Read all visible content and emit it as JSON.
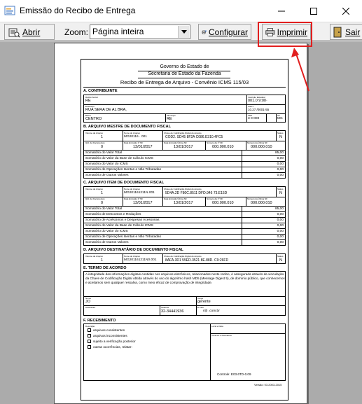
{
  "window": {
    "title": "Emissão do Recibo de Entrega",
    "controls": {
      "minimize": "minimize",
      "maximize": "maximize",
      "close": "close"
    }
  },
  "toolbar": {
    "open_label": "Abrir",
    "zoom_label": "Zoom:",
    "zoom_value": "Página inteira",
    "config_label": "Configurar",
    "print_label": "Imprimir",
    "exit_label": "Sair",
    "highlight_color": "#e11f1f"
  },
  "document": {
    "header": {
      "line1": "Governo do Estado de",
      "line2": "Secretaria de Estado da Fazenda",
      "line3": "Recibo de Entrega de Arquivo - Convênio ICMS 115/03"
    },
    "section_a": {
      "title": "A. CONTRIBUINTE",
      "razao_label": "Razão Social",
      "razao_value": "RE",
      "ie_label": "Inscrição Estadual",
      "ie_value": "001.0 9:00·",
      "endereco_label": "Endereço",
      "endereco_value": "RUA SERA DE AL BRA,",
      "cnpj_label": "CNPJ",
      "cnpj_value": "10.27 /0001-55",
      "bairro_label": "Bairro",
      "bairro_value": "CENTRO",
      "municipio_label": "Município",
      "municipio_value": "RE",
      "cep_label": "CEP",
      "cep_value": "3 0-000",
      "uf_label": "UF",
      "uf_value": "MG"
    },
    "section_b": {
      "title": "B. ARQUIVO MESTRE DE DOCUMENTO FISCAL",
      "volumes_label": "Volume da Arquivo",
      "volumes_value": "1",
      "nome_label": "Nome do Arquivo",
      "nome_value": "MG20116 · 001",
      "chave_label": "Chave de Codificação Digital do Arquivo",
      "chave_value": "COD2. SD45 8F2A C086.E310.4FC5",
      "status_label": "Status",
      "status_value": "N",
      "qtd_label": "Qtd. de Documentos",
      "qtd_value": "0",
      "data_ini_label": "Data Emissão 1º NF",
      "data_ini_value": "13/01/2017",
      "data_fim_label": "Data Emissão Última NF",
      "data_fim_value": "13/01/2017",
      "num_ini_label": "Número da 1º NF",
      "num_ini_value": "000.000.010",
      "num_fim_label": "Número da Última NF",
      "num_fim_value": "000.000.010",
      "rows": [
        {
          "label": "Somatório do Valor Total",
          "value": "85,00"
        },
        {
          "label": "Somatório do Valor da Base de Cálculo ICMS",
          "value": "0,00"
        },
        {
          "label": "Somatório do Valor do ICMS",
          "value": "0,00"
        },
        {
          "label": "Somatório de Operações Isentas e Não Tributadas",
          "value": "0,00"
        },
        {
          "label": "Somatório de Outros Valores",
          "value": "0,00"
        }
      ]
    },
    "section_c": {
      "title": "C. ARQUIVO ITEM DE DOCUMENTO FISCAL",
      "volumes_value": "1",
      "nome_value": "MG201161211N.001",
      "chave_value": "5D4A.2D F80C.8511 DFD.946 73.E15D",
      "status_value": "N",
      "qtd_value": "0",
      "data_ini_value": "13/01/2017",
      "data_fim_value": "13/01/2017",
      "num_ini_value": "000.000.010",
      "num_fim_value": "000.000.010",
      "rows": [
        {
          "label": "Somatório do Valor Total",
          "value": "85,00"
        },
        {
          "label": "Somatório de Descontos e Reduções",
          "value": "0,00"
        },
        {
          "label": "Somatório de Acréscimos e Despesas Acessórias",
          "value": "0,00"
        },
        {
          "label": "Somatório do Valor da Base de Cálculo ICMS",
          "value": "0,00"
        },
        {
          "label": "Somatório do Valor do ICMS",
          "value": "0,00"
        },
        {
          "label": "Somatório de Operações Isentas e Não Tributadas",
          "value": "0,00"
        },
        {
          "label": "Somatório de Outros Valores",
          "value": "0,00"
        }
      ]
    },
    "section_d": {
      "title": "D. ARQUIVO DESTINATÁRIO DE DOCUMENTO FISCAL",
      "volumes_value": "1",
      "nome_value": "MG201161211N0.001",
      "chave_value": "8AFA.3D1 55ED.3521 8E.88D. C9:26FD",
      "status_value": "N"
    },
    "section_e": {
      "title": "E. TERMO DE ACORDO",
      "text": "A integridade das informações digitais contidas nos arquivos eletrônicos, relacionados neste recibo, é assegurada através da vinculação da Chave de Codificação Digital obtida através do uso do algoritmo hash MD5 (Message Digest 5), de domínio público, que conhecemos e aceitamos sem qualquer ressalva, como meio eficaz de comprovação de integridade.",
      "nome_label": "Nome",
      "nome_value": "JO",
      "cargo_label": "Cargo",
      "cargo_value": "gerente",
      "assinatura_label": "Assinatura",
      "telefone_label": "Telefone",
      "telefone_value": "32-34441936",
      "email_label": "E-mail",
      "email_value": "r@ .com.br"
    },
    "section_f": {
      "title": "F. RECEBIMENTO",
      "descricao_label": "Descrição",
      "local_label": "Local e Data",
      "carimbo_label": "Carimbo e Assinatura",
      "checks": [
        "arquivos consistentes",
        "arquivos inconsistentes",
        "sujeito a verificação posterior",
        "outras ocorrências, relatar:"
      ],
      "controle": "Controle: E03.6TD-0.09",
      "versao": "Versão: 03.2003-2015"
    }
  }
}
